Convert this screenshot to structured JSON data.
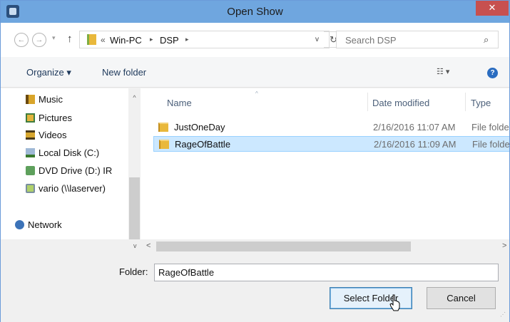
{
  "window": {
    "title": "Open Show",
    "close_glyph": "✕",
    "icon": "app-icon"
  },
  "navigation": {
    "back_glyph": "←",
    "forward_glyph": "→",
    "recent_glyph": "▾",
    "up_glyph": "↑",
    "address": {
      "overflow_chevrons": "«",
      "crumbs": [
        "Win-PC",
        "DSP"
      ],
      "separator": "▸",
      "dropdown_glyph": "v",
      "refresh_glyph": "↻"
    },
    "search": {
      "placeholder": "Search DSP",
      "icon_glyph": "⌕"
    }
  },
  "toolbar": {
    "organize_label": "Organize ▾",
    "new_folder_label": "New folder",
    "view_label": "☷ ▾",
    "help_glyph": "?"
  },
  "nav_pane": {
    "items": [
      {
        "label": "Music",
        "icon": "music-folder-icon"
      },
      {
        "label": "Pictures",
        "icon": "pictures-folder-icon"
      },
      {
        "label": "Videos",
        "icon": "videos-folder-icon"
      },
      {
        "label": "Local Disk (C:)",
        "icon": "local-disk-icon"
      },
      {
        "label": "DVD Drive (D:) IR",
        "icon": "dvd-drive-icon"
      },
      {
        "label": "vario (\\\\laserver)",
        "icon": "network-drive-icon"
      },
      {
        "label": "Network",
        "icon": "network-icon"
      }
    ],
    "scroll_up_glyph": "^",
    "scroll_down_glyph": "v"
  },
  "file_list": {
    "columns": {
      "name": "Name",
      "date": "Date modified",
      "type": "Type"
    },
    "sort_glyph": "^",
    "rows": [
      {
        "name": "JustOneDay",
        "date": "2/16/2016 11:07 AM",
        "type": "File folder",
        "selected": false
      },
      {
        "name": "RageOfBattle",
        "date": "2/16/2016 11:09 AM",
        "type": "File folder",
        "selected": true
      }
    ],
    "hscroll_left_glyph": "<",
    "hscroll_right_glyph": ">"
  },
  "bottom": {
    "folder_label": "Folder:",
    "folder_value": "RageOfBattle",
    "select_folder_label": "Select Folder",
    "cancel_label": "Cancel",
    "resize_glyph": "⋰"
  },
  "colors": {
    "titlebar": "#6fa6df",
    "close_button": "#c7504f",
    "selection_bg": "#cce8ff",
    "selection_border": "#99d1ff",
    "default_button_border": "#3c7fb1"
  }
}
